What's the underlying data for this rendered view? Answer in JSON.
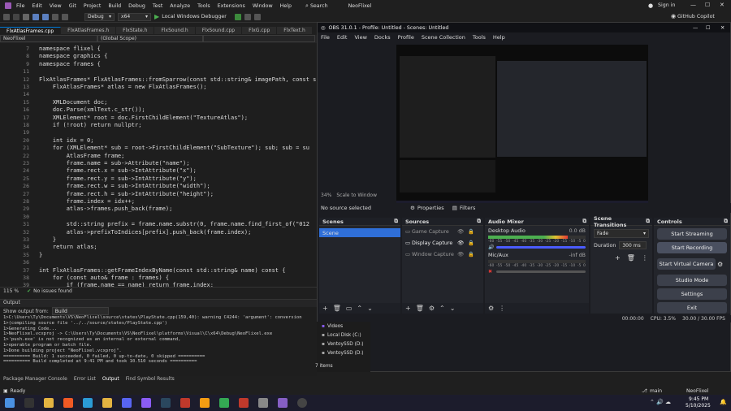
{
  "vs": {
    "menu": [
      "File",
      "Edit",
      "View",
      "Git",
      "Project",
      "Build",
      "Debug",
      "Test",
      "Analyze",
      "Tools",
      "Extensions",
      "Window",
      "Help"
    ],
    "search": "Search",
    "solution_name": "NeoFlixel",
    "sign_in": "Sign in",
    "copilot": "GitHub Copilot",
    "toolbar": {
      "config": "Debug",
      "platform": "x64",
      "run": "Local Windows Debugger"
    },
    "tabs": [
      "FlxAtlasFrames.cpp",
      "FlxAtlasFrames.h",
      "FlxState.h",
      "FlxSound.h",
      "FlxSound.cpp",
      "FlxG.cpp",
      "FlxText.h"
    ],
    "nav": {
      "project": "NeoFlixel",
      "scope": "(Global Scope)"
    },
    "code_lines": [
      {
        "n": "7",
        "t": "namespace flixel {"
      },
      {
        "n": "8",
        "t": "namespace graphics {"
      },
      {
        "n": "9",
        "t": "namespace frames {"
      },
      {
        "n": "11",
        "t": ""
      },
      {
        "n": "12",
        "t": "FlxAtlasFrames* FlxAtlasFrames::fromSparrow(const std::string& imagePath, const s"
      },
      {
        "n": "13",
        "t": "    FlxAtlasFrames* atlas = new FlxAtlasFrames();"
      },
      {
        "n": "14",
        "t": ""
      },
      {
        "n": "15",
        "t": "    XMLDocument doc;"
      },
      {
        "n": "16",
        "t": "    doc.Parse(xmlText.c_str());"
      },
      {
        "n": "17",
        "t": "    XMLElement* root = doc.FirstChildElement(\"TextureAtlas\");"
      },
      {
        "n": "18",
        "t": "    if (!root) return nullptr;"
      },
      {
        "n": "19",
        "t": ""
      },
      {
        "n": "20",
        "t": "    int idx = 0;"
      },
      {
        "n": "21",
        "t": "    for (XMLElement* sub = root->FirstChildElement(\"SubTexture\"); sub; sub = su"
      },
      {
        "n": "22",
        "t": "        AtlasFrame frame;"
      },
      {
        "n": "23",
        "t": "        frame.name = sub->Attribute(\"name\");"
      },
      {
        "n": "24",
        "t": "        frame.rect.x = sub->IntAttribute(\"x\");"
      },
      {
        "n": "25",
        "t": "        frame.rect.y = sub->IntAttribute(\"y\");"
      },
      {
        "n": "26",
        "t": "        frame.rect.w = sub->IntAttribute(\"width\");"
      },
      {
        "n": "27",
        "t": "        frame.rect.h = sub->IntAttribute(\"height\");"
      },
      {
        "n": "28",
        "t": "        frame.index = idx++;"
      },
      {
        "n": "29",
        "t": "        atlas->frames.push_back(frame);"
      },
      {
        "n": "30",
        "t": ""
      },
      {
        "n": "31",
        "t": "        std::string prefix = frame.name.substr(0, frame.name.find_first_of(\"012"
      },
      {
        "n": "32",
        "t": "        atlas->prefixToIndices[prefix].push_back(frame.index);"
      },
      {
        "n": "33",
        "t": "    }"
      },
      {
        "n": "34",
        "t": "    return atlas;"
      },
      {
        "n": "35",
        "t": "}"
      },
      {
        "n": "36",
        "t": ""
      },
      {
        "n": "37",
        "t": "int FlxAtlasFrames::getFrameIndexByName(const std::string& name) const {"
      },
      {
        "n": "38",
        "t": "    for (const auto& frame : frames) {"
      },
      {
        "n": "39",
        "t": "        if (frame.name == name) return frame.index;"
      }
    ],
    "editor_status": {
      "zoom": "115 %",
      "issues": "No issues found"
    },
    "output": {
      "header": "Output",
      "from_label": "Show output from:",
      "from_value": "Build",
      "lines": [
        "1>C:\\Users\\Ty\\Documents\\VS\\NeoFlixel\\source\\states\\PlayState.cpp(159,40): warning C4244: 'argument': conversion",
        "1>(compiling source file '../../source/states/PlayState.cpp')",
        "1>Generating Code...",
        "1>NeoFlixel.vcxproj -> C:\\Users\\Ty\\Documents\\VS\\NeoFlixel\\platforms\\Visual\\C\\x64\\Debug\\NeoFlixel.exe",
        "1>'push.exe' is not recognized as an internal or external command,",
        "1>operable program or batch file.",
        "1>Done building project \"NeoFlixel.vcxproj\".",
        "========== Build: 1 succeeded, 0 failed, 0 up-to-date, 0 skipped ==========",
        "========== Build completed at 9:41 PM and took 10.510 seconds =========="
      ]
    },
    "bottom_tabs": [
      "Package Manager Console",
      "Error List",
      "Output",
      "Find Symbol Results"
    ],
    "status": {
      "ready": "Ready",
      "branch": "main",
      "project": "NeoFlixel"
    }
  },
  "obs": {
    "title": "OBS 31.0.1 - Profile: Untitled - Scenes: Untitled",
    "menu": [
      "File",
      "Edit",
      "View",
      "Docks",
      "Profile",
      "Scene Collection",
      "Tools",
      "Help"
    ],
    "zoom": "34%",
    "scale_label": "Scale to Window",
    "no_source": "No source selected",
    "properties": "Properties",
    "filters": "Filters",
    "scenes": {
      "title": "Scenes",
      "items": [
        "Scene"
      ]
    },
    "sources": {
      "title": "Sources",
      "items": [
        "Game Capture",
        "Display Capture",
        "Window Capture"
      ]
    },
    "mixer": {
      "title": "Audio Mixer",
      "channels": [
        {
          "name": "Desktop Audio",
          "db": "0.0 dB",
          "level": 0.82
        },
        {
          "name": "Mic/Aux",
          "db": "-inf dB",
          "level": 0.0
        }
      ],
      "scale": [
        "-60",
        "-55",
        "-50",
        "-45",
        "-40",
        "-35",
        "-30",
        "-25",
        "-20",
        "-15",
        "-10",
        "-5",
        "0"
      ]
    },
    "transitions": {
      "title": "Scene Transitions",
      "type": "Fade",
      "duration_label": "Duration",
      "duration": "300 ms"
    },
    "controls": {
      "title": "Controls",
      "buttons": [
        "Start Streaming",
        "Start Recording",
        "Start Virtual Camera",
        "Studio Mode",
        "Settings",
        "Exit"
      ]
    },
    "status": {
      "cpu": "CPU: 3.5%",
      "fps": "30.00 / 30.00 FPS",
      "time": "00:00:00"
    },
    "colors": {
      "bg": "#1b1c21",
      "panel": "#23252b",
      "button": "#3c404b",
      "accent": "#4a5cff",
      "meter_green": "#4caf50",
      "meter_red": "#e53935"
    }
  },
  "explorer": {
    "items": [
      "Videos",
      "Local Disk (C:)",
      "VentoySSD (D:)",
      "VentoySSD (D:)"
    ],
    "count": "7 items"
  },
  "taskbar": {
    "time": "9:45 PM",
    "date": "5/10/2025"
  }
}
